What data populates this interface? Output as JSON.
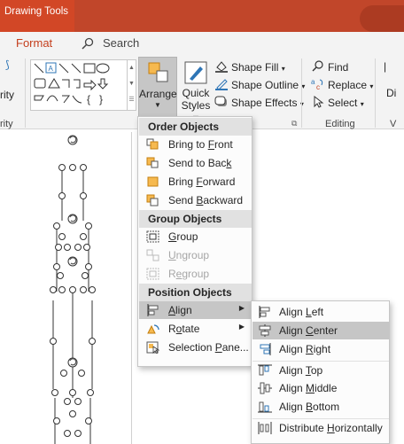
{
  "titlebar": {
    "context_tab": "Drawing Tools"
  },
  "tabs": {
    "format": "Format",
    "search": "Search"
  },
  "ribbon": {
    "left_partial": "rity",
    "left_group_partial": "rity",
    "arrange_label": "Arrange",
    "quick_styles_line1": "Quick",
    "quick_styles_line2": "Styles",
    "shape_fill": "Shape Fill",
    "shape_outline": "Shape Outline",
    "shape_effects": "Shape Effects",
    "find": "Find",
    "replace": "Replace",
    "select": "Select",
    "editing_group": "Editing",
    "right_partial_1": "Di",
    "right_partial_2": "V"
  },
  "menu": {
    "order_header": "Order Objects",
    "bring_to_front": [
      "Bring to ",
      "F",
      "ront"
    ],
    "send_to_back": [
      "Send to Bac",
      "k",
      ""
    ],
    "bring_forward": [
      "Bring ",
      "F",
      "orward"
    ],
    "send_backward": [
      "Send ",
      "B",
      "ackward"
    ],
    "group_header": "Group Objects",
    "group": [
      "",
      "G",
      "roup"
    ],
    "ungroup": [
      "",
      "U",
      "ngroup"
    ],
    "regroup": [
      "R",
      "e",
      "group"
    ],
    "position_header": "Position Objects",
    "align": [
      "",
      "A",
      "lign"
    ],
    "rotate": [
      "R",
      "o",
      "tate"
    ],
    "selection_pane": [
      "Selection ",
      "P",
      "ane..."
    ]
  },
  "submenu": {
    "align_left": [
      "Align ",
      "L",
      "eft"
    ],
    "align_center": [
      "Align ",
      "C",
      "enter"
    ],
    "align_right": [
      "Align ",
      "R",
      "ight"
    ],
    "align_top": [
      "Align ",
      "T",
      "op"
    ],
    "align_middle": [
      "Align ",
      "M",
      "iddle"
    ],
    "align_bottom": [
      "Align ",
      "B",
      "ottom"
    ],
    "distribute_horizontally": [
      "Distribute ",
      "H",
      "orizontally"
    ]
  },
  "colors": {
    "titlebar": "#c1462a",
    "accent": "#c43e1c",
    "highlight": "#c6c6c6",
    "icon_orange": "#f6b94f",
    "icon_blue": "#2e75b6"
  }
}
